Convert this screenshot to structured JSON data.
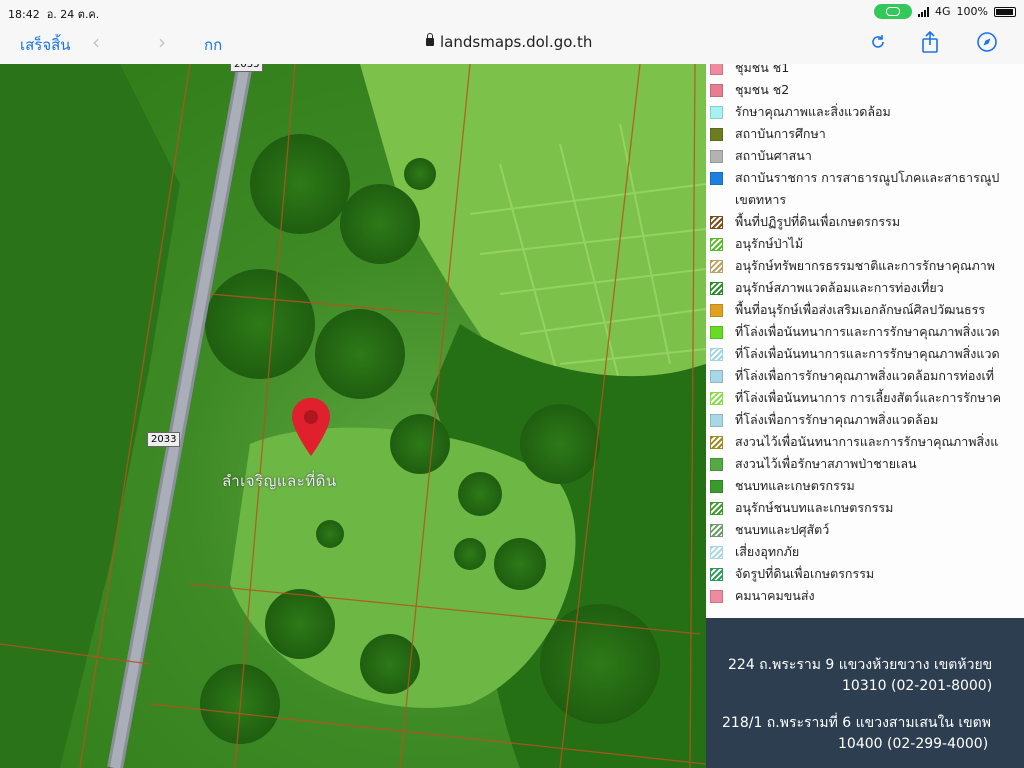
{
  "status_bar": {
    "time": "18:42",
    "date": "อ. 24 ต.ค.",
    "network": "4G",
    "battery": "100%"
  },
  "browser": {
    "done_label": "เสร็จสิ้น",
    "back_glyph": "‹",
    "forward_glyph": "›",
    "text_size_label": "กก",
    "url": "landsmaps.dol.go.th"
  },
  "map": {
    "road_label_top": "2033",
    "road_label": "2033",
    "place_label": "ลำเจริญและที่ดิน"
  },
  "legend": [
    {
      "label": "ชุมชน ช1",
      "color": "#f08a9e",
      "pattern": "solid"
    },
    {
      "label": "ชุมชน ช2",
      "color": "#e87d92",
      "pattern": "solid"
    },
    {
      "label": "รักษาคุณภาพและสิ่งแวดล้อม",
      "color": "#a6f2f0",
      "pattern": "solid"
    },
    {
      "label": "สถาบันการศึกษา",
      "color": "#6b7d1f",
      "pattern": "solid"
    },
    {
      "label": "สถาบันศาสนา",
      "color": "#b3b3b3",
      "pattern": "solid"
    },
    {
      "label": "สถาบันราชการ การสาธารณูปโภคและสาธารณูป",
      "color": "#1f7fe0",
      "pattern": "solid"
    },
    {
      "label": "เขตทหาร",
      "color": "",
      "pattern": "none"
    },
    {
      "label": "พื้นที่ปฏิรูปที่ดินเพื่อเกษตรกรรม",
      "color": "#7a4a1a",
      "pattern": "hatch"
    },
    {
      "label": "อนุรักษ์ป่าไม้",
      "color": "#55bb22",
      "pattern": "hatch"
    },
    {
      "label": "อนุรักษ์ทรัพยากรธรรมชาติและการรักษาคุณภาพ",
      "color": "#bba060",
      "pattern": "hatch"
    },
    {
      "label": "อนุรักษ์สภาพแวดล้อมและการท่องเที่ยว",
      "color": "#2a8a2a",
      "pattern": "hatch"
    },
    {
      "label": "พื้นที่อนุรักษ์เพื่อส่งเสริมเอกลักษณ์ศิลปวัฒนธรร",
      "color": "#e0a020",
      "pattern": "solid"
    },
    {
      "label": "ที่โล่งเพื่อนันทนาการและการรักษาคุณภาพสิ่งแวด",
      "color": "#66dd22",
      "pattern": "solid"
    },
    {
      "label": "ที่โล่งเพื่อนันทนาการและการรักษาคุณภาพสิ่งแวด",
      "color": "#9cd4ea",
      "pattern": "hatch"
    },
    {
      "label": "ที่โล่งเพื่อการรักษาคุณภาพสิ่งแวดล้อมการท่องเที่",
      "color": "#a8d8e8",
      "pattern": "solid"
    },
    {
      "label": "ที่โล่งเพื่อนันทนาการ การเลี้ยงสัตว์และการรักษาค",
      "color": "#88dd44",
      "pattern": "hatch"
    },
    {
      "label": "ที่โล่งเพื่อการรักษาคุณภาพสิ่งแวดล้อม",
      "color": "#a8d8e8",
      "pattern": "solid"
    },
    {
      "label": "สงวนไว้เพื่อนันทนาการและการรักษาคุณภาพสิ่งแ",
      "color": "#9a8a20",
      "pattern": "hatch"
    },
    {
      "label": "สงวนไว้เพื่อรักษาสภาพป่าชายเลน",
      "color": "#55aa44",
      "pattern": "solid"
    },
    {
      "label": "ชนบทและเกษตรกรรม",
      "color": "#3a9a2a",
      "pattern": "solid"
    },
    {
      "label": "อนุรักษ์ชนบทและเกษตรกรรม",
      "color": "#3a9a2a",
      "pattern": "hatch"
    },
    {
      "label": "ชนบทและปศุสัตว์",
      "color": "#6a9a6a",
      "pattern": "hatch"
    },
    {
      "label": "เสี่ยงอุทกภัย",
      "color": "#a8d8e8",
      "pattern": "hatch"
    },
    {
      "label": "จัดรูปที่ดินเพื่อเกษตรกรรม",
      "color": "#2a9a5a",
      "pattern": "hatch"
    },
    {
      "label": "คมนาคมขนส่ง",
      "color": "#f08a9e",
      "pattern": "solid"
    }
  ],
  "info": {
    "address1_line1": "224 ถ.พระราม 9 แขวงห้วยขวาง เขตห้วยข",
    "address1_line2": "10310 (02-201-8000)",
    "address2_line1": "218/1 ถ.พระรามที่ 6 แขวงสามเสนใน เขตพ",
    "address2_line2": "10400 (02-299-4000)"
  },
  "colors": {
    "accent": "#1a73e8",
    "info_bg": "#2c3e50",
    "map_green": "#3e8a25",
    "pin": "#e0202c"
  }
}
